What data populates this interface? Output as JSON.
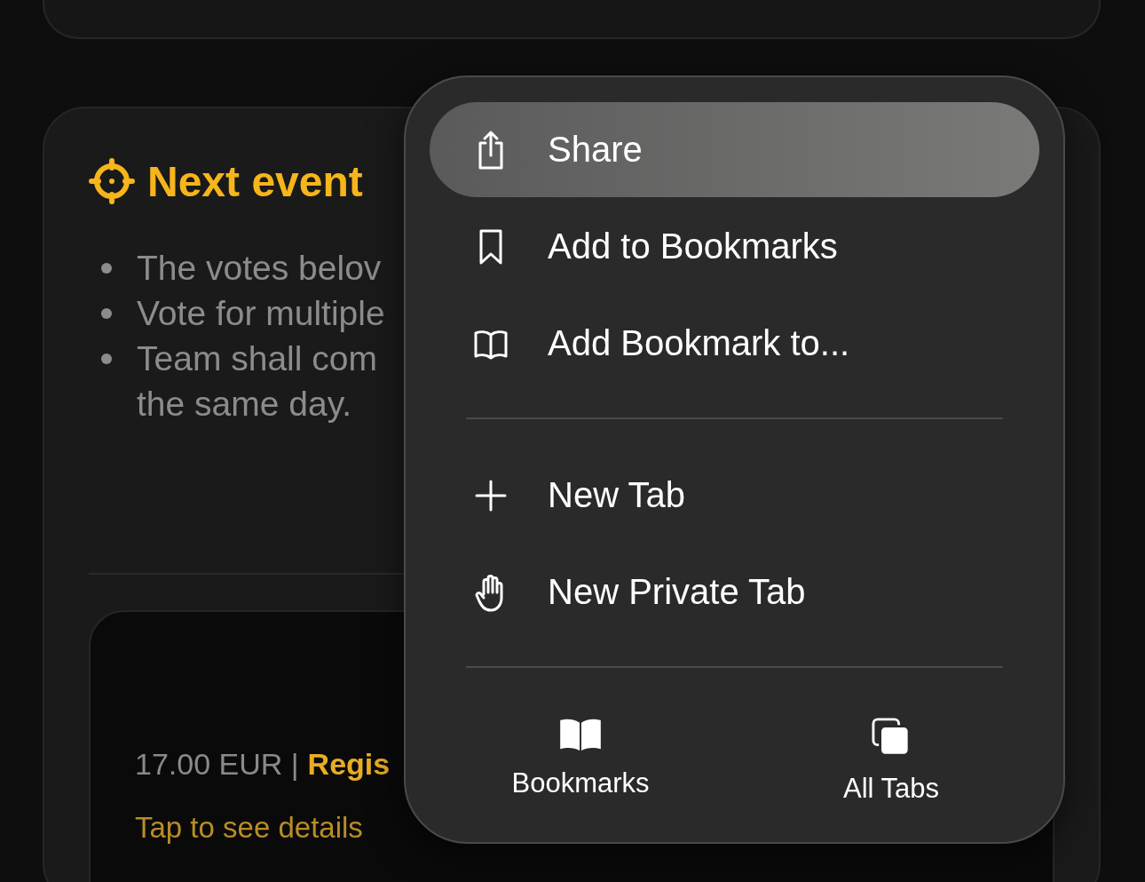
{
  "events_card": {
    "title": "Next event",
    "bullets": [
      "The votes belov",
      "Vote for multiple",
      "Team shall com"
    ],
    "continuation": "the same day.",
    "event": {
      "price": "17.00 EUR |",
      "register": "Regis",
      "details": "Tap to see details"
    }
  },
  "menu": {
    "items": [
      {
        "kind": "share",
        "label": "Share",
        "selected": true
      },
      {
        "kind": "bookmark",
        "label": "Add to Bookmarks",
        "selected": false
      },
      {
        "kind": "book",
        "label": "Add Bookmark to...",
        "selected": false
      },
      {
        "kind": "divider"
      },
      {
        "kind": "plus",
        "label": "New Tab",
        "selected": false
      },
      {
        "kind": "hand",
        "label": "New Private Tab",
        "selected": false
      },
      {
        "kind": "divider"
      }
    ],
    "actions": [
      {
        "kind": "books",
        "label": "Bookmarks"
      },
      {
        "kind": "tabs",
        "label": "All Tabs"
      }
    ]
  }
}
